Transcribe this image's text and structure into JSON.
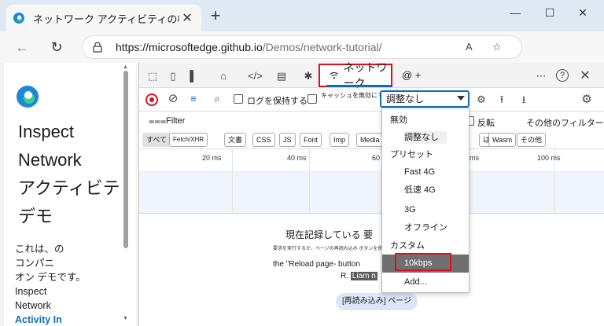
{
  "browser": {
    "tab_title": "ネットワーク アクティビティの検査のデモ",
    "tab_close": "✕",
    "new_tab": "+",
    "url_host": "https://microsoftedge.github.io",
    "url_path": "/Demos/network-tutorial/",
    "read_aloud": "A",
    "window_controls": {
      "minimize": "—",
      "maximize": "☐",
      "close": "✕"
    }
  },
  "page": {
    "heading_lines": [
      "Inspect",
      "Network",
      "アクティビテ",
      "デモ"
    ],
    "desc_lines": [
      "これは、の",
      "コンパニ",
      "オン デモです。",
      "Inspect",
      "Network",
      "Activity In"
    ]
  },
  "devtools": {
    "network_tab_label": "ネットワーク",
    "network_tab_extra": "@ +",
    "preserve_log": "ログを保持する",
    "disable_cache": "キャッシュを無効にする",
    "throttle_value": "調整なし",
    "filter_label": "Filter",
    "invert_label": "反転",
    "more_filters": "その他のフィルター",
    "type_chips": [
      "すべて",
      "Fetch/XHR",
      "文書",
      "CSS",
      "JS",
      "Font",
      "Imp",
      "Media",
      "は",
      "Wasm",
      "その他"
    ],
    "ticks": [
      "20 ms",
      "40 ms",
      "60",
      "ms",
      "100 ms"
    ],
    "empty_message": "現在記録している 要",
    "empty_small": "要求を実行するか、ページの再読み込み ボタンを使用して...",
    "reload_line": "the \"Reload page- button",
    "name_prefix": "R.",
    "name_highlight": "Liam n",
    "reload_button": "[再読み込み] ページ"
  },
  "throttle_dropdown": {
    "items": [
      {
        "kind": "group",
        "label": "無効"
      },
      {
        "kind": "option",
        "label": "調整なし",
        "state": "selected"
      },
      {
        "kind": "group",
        "label": "プリセット"
      },
      {
        "kind": "option",
        "label": "Fast 4G"
      },
      {
        "kind": "option",
        "label": "低速 4G"
      },
      {
        "kind": "option",
        "label": "3G"
      },
      {
        "kind": "option",
        "label": "オフライン"
      },
      {
        "kind": "group",
        "label": "カスタム"
      },
      {
        "kind": "option",
        "label": "10kbps",
        "state": "highlighted"
      },
      {
        "kind": "option",
        "label": "Add..."
      }
    ]
  },
  "colors": {
    "accent": "#0f6cbd",
    "record_red": "#d9121e",
    "highlight_red_box": "#d9121e"
  }
}
